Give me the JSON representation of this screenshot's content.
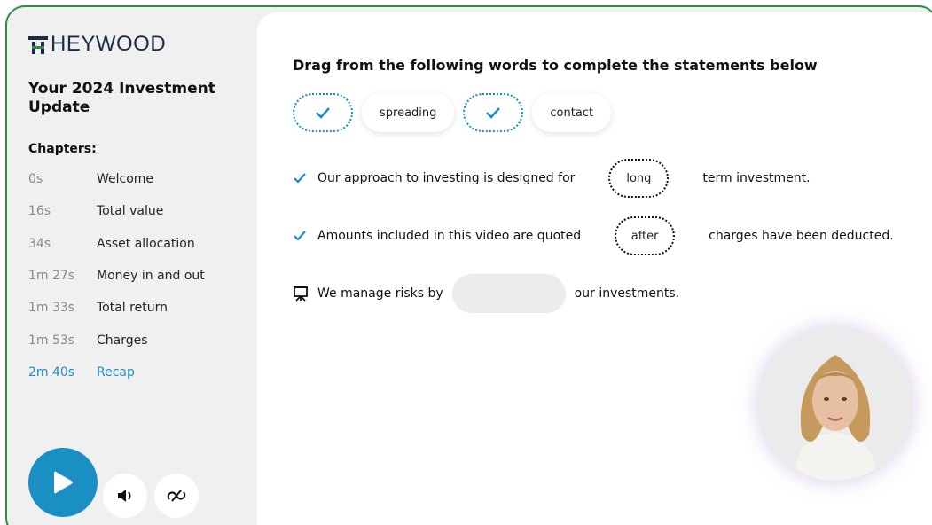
{
  "brand": {
    "logo_text": "HEYWOOD",
    "accent": "#1a8fc4",
    "frame_color": "#2e8b4a"
  },
  "sidebar": {
    "title": "Your 2024 Investment Update",
    "chapters_heading": "Chapters:",
    "chapters": [
      {
        "time": "0s",
        "label": "Welcome"
      },
      {
        "time": "16s",
        "label": "Total value"
      },
      {
        "time": "34s",
        "label": "Asset allocation"
      },
      {
        "time": "1m 27s",
        "label": "Money in and out"
      },
      {
        "time": "1m 33s",
        "label": "Total return"
      },
      {
        "time": "1m 53s",
        "label": "Charges"
      },
      {
        "time": "2m 40s",
        "label": "Recap",
        "active": true
      }
    ]
  },
  "controls": {
    "play_icon": "play-icon",
    "mute_icon": "volume-icon",
    "captions_icon": "captions-off-icon"
  },
  "activity": {
    "instruction": "Drag from the following words to complete the statements below",
    "word_bank": [
      {
        "state": "used",
        "icon": "check-icon"
      },
      {
        "state": "available",
        "label": "spreading"
      },
      {
        "state": "used",
        "icon": "check-icon"
      },
      {
        "state": "available",
        "label": "contact"
      }
    ],
    "statements": [
      {
        "status": "correct",
        "icon": "check-icon",
        "prefix": "Our approach to investing is designed for",
        "answer": "long",
        "suffix": "term investment."
      },
      {
        "status": "correct",
        "icon": "check-icon",
        "prefix": "Amounts included in this video are quoted",
        "answer": "after",
        "suffix": "charges have been deducted."
      },
      {
        "status": "pending",
        "icon": "presentation-icon",
        "prefix": "We manage risks by",
        "answer": "",
        "suffix": "our investments."
      }
    ]
  },
  "presenter": {
    "icon": "presenter-avatar"
  }
}
